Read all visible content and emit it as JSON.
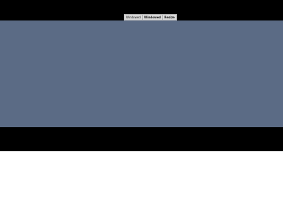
{
  "menu": {
    "items": [
      {
        "label": "Windowed"
      },
      {
        "label": "Windowed"
      },
      {
        "label": "Resize"
      }
    ]
  },
  "colors": {
    "letterbox": "#000000",
    "canvas": "#5b6b85",
    "background": "#ffffff",
    "menu_bg": "#d9d9d9"
  }
}
